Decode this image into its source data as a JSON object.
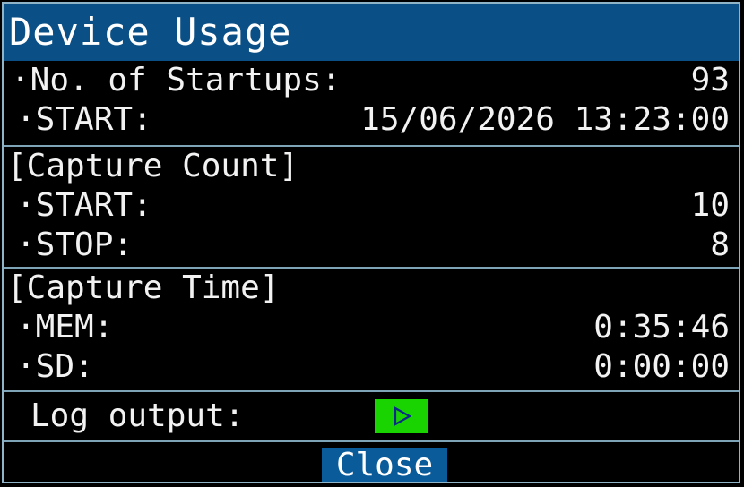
{
  "window": {
    "title": "Device Usage"
  },
  "startups": {
    "label": "·No. of Startups:",
    "value": "93",
    "start_label": "·START:",
    "start_value": "15/06/2026 13:23:00"
  },
  "capture_count": {
    "header": "[Capture Count]",
    "start_label": "·START:",
    "start_value": "10",
    "stop_label": "·STOP:",
    "stop_value": "8"
  },
  "capture_time": {
    "header": "[Capture Time]",
    "mem_label": "·MEM:",
    "mem_value": "0:35:46",
    "sd_label": "·SD:",
    "sd_value": "0:00:00"
  },
  "log_output": {
    "label": "Log output:",
    "button_icon": "play-icon"
  },
  "footer": {
    "close_label": "Close"
  },
  "colors": {
    "title_bar": "#0a4f86",
    "background": "#000000",
    "separator": "#7ea4b8",
    "play_button": "#19d400",
    "close_button": "#0a5b99"
  }
}
